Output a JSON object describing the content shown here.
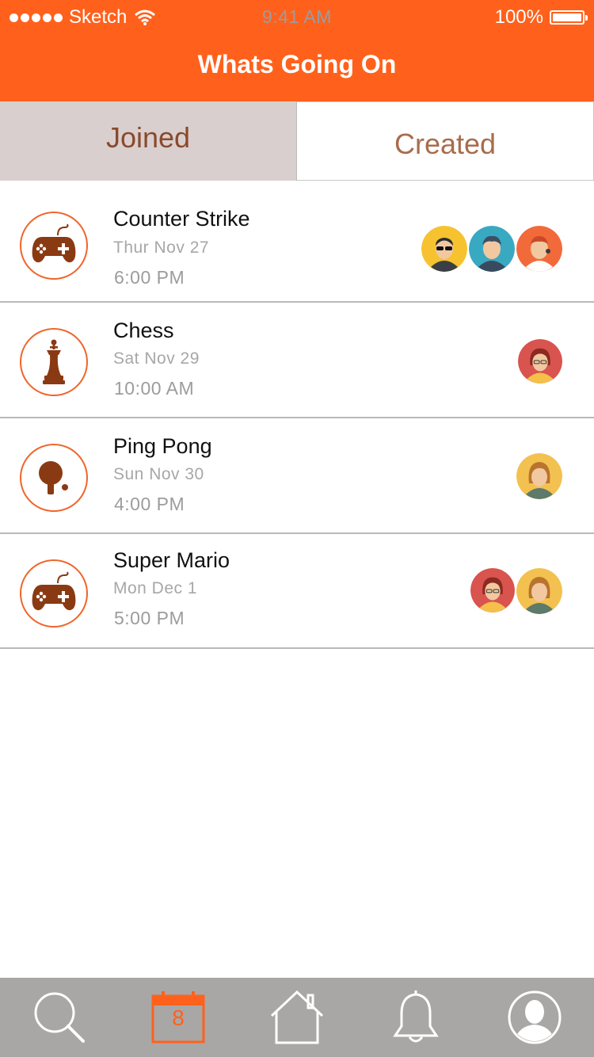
{
  "status_bar": {
    "carrier": "Sketch",
    "time": "9:41 AM",
    "battery": "100%"
  },
  "header": {
    "title": "Whats Going On"
  },
  "tabs": [
    {
      "label": "Joined",
      "selected": true
    },
    {
      "label": "Created",
      "selected": false
    }
  ],
  "events": [
    {
      "name": "Counter Strike",
      "date": "Thur  Nov 27",
      "time": "6:00 PM",
      "icon": "gamepad-icon",
      "attendees": [
        "avatar-sunglasses-man",
        "avatar-man-blue",
        "avatar-man-orange"
      ]
    },
    {
      "name": "Chess",
      "date": "Sat  Nov 29",
      "time": "10:00 AM",
      "icon": "chess-king-icon",
      "attendees": [
        "avatar-woman-red"
      ]
    },
    {
      "name": "Ping Pong",
      "date": "Sun  Nov 30",
      "time": "4:00 PM",
      "icon": "ping-pong-icon",
      "attendees": [
        "avatar-woman-yellow"
      ]
    },
    {
      "name": "Super Mario",
      "date": "Mon  Dec 1",
      "time": "5:00 PM",
      "icon": "gamepad-icon",
      "attendees": [
        "avatar-woman-red",
        "avatar-woman-yellow"
      ]
    }
  ],
  "tabbar": {
    "calendar_day": "8",
    "items": [
      "search-icon",
      "calendar-icon",
      "home-icon",
      "bell-icon",
      "profile-icon"
    ]
  },
  "colors": {
    "accent": "#ff611c",
    "icon_brown": "#8a3a12",
    "tabbar_bg": "#a8a7a6"
  }
}
